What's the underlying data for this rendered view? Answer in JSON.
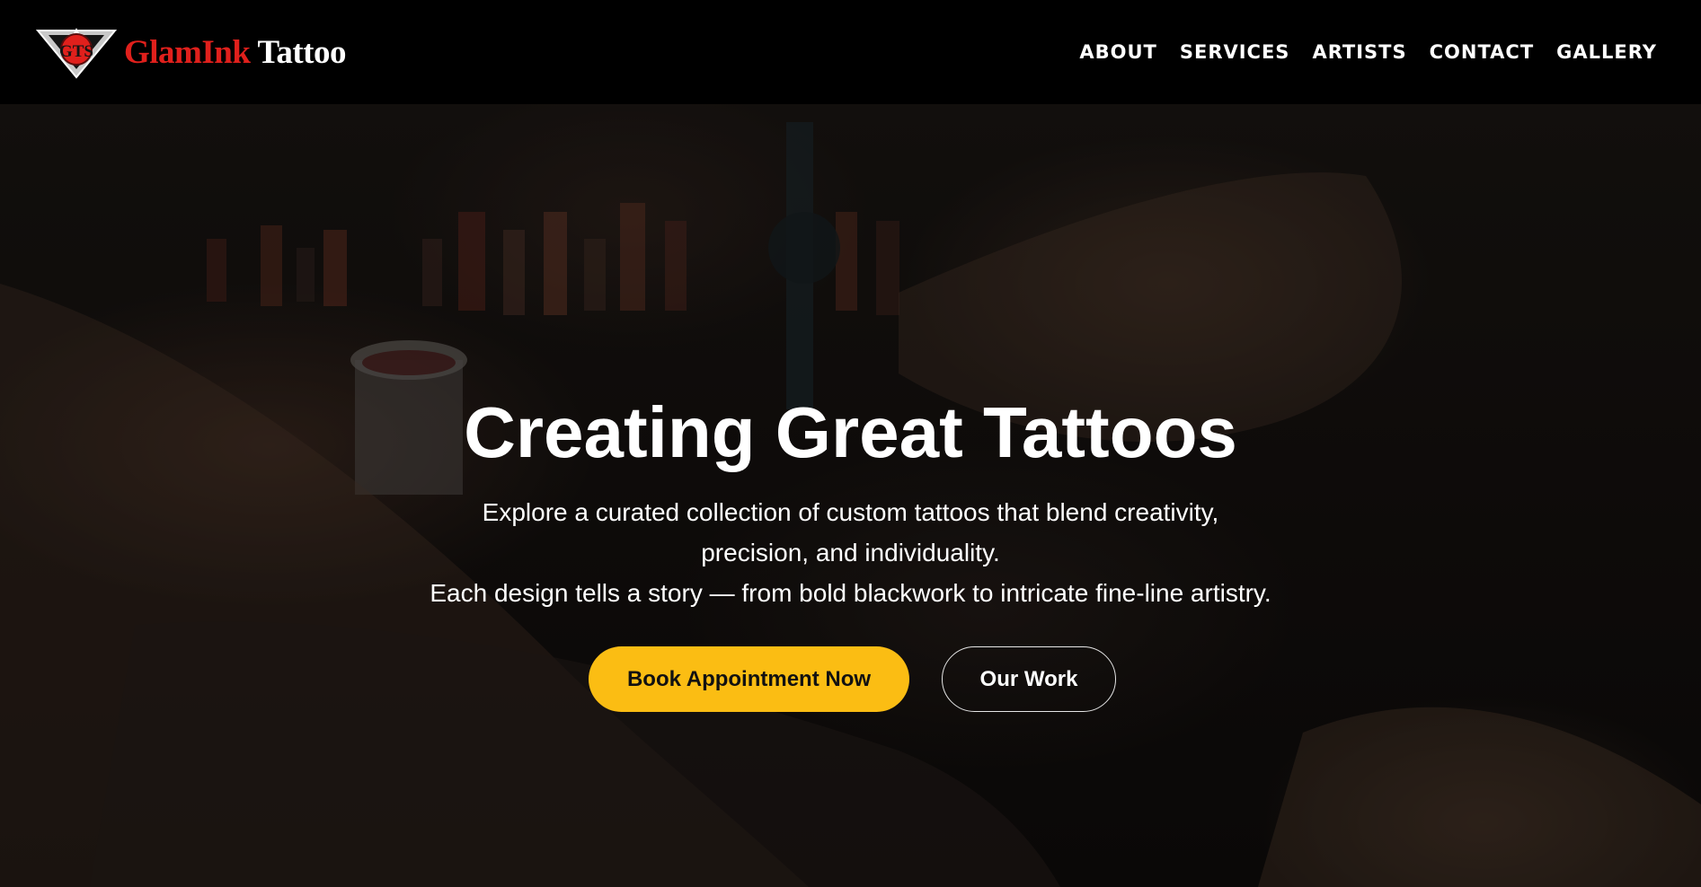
{
  "header": {
    "logo_initials": "GTS",
    "brand_part1": "GlamInk",
    "brand_part2": "Tattoo",
    "nav": [
      {
        "label": "ABOUT"
      },
      {
        "label": "SERVICES"
      },
      {
        "label": "ARTISTS"
      },
      {
        "label": "CONTACT"
      },
      {
        "label": "GALLERY"
      }
    ]
  },
  "hero": {
    "title": "Creating Great Tattoos",
    "subtitle_lines": [
      "Explore a curated collection of custom tattoos that blend creativity,",
      "precision, and individuality.",
      "Each design tells a story — from bold blackwork to intricate fine-line artistry."
    ],
    "primary_button": "Book Appointment Now",
    "secondary_button": "Our Work"
  },
  "colors": {
    "header_bg": "#000000",
    "brand_red": "#e0201c",
    "accent_yellow": "#fbbd13",
    "text": "#ffffff"
  }
}
